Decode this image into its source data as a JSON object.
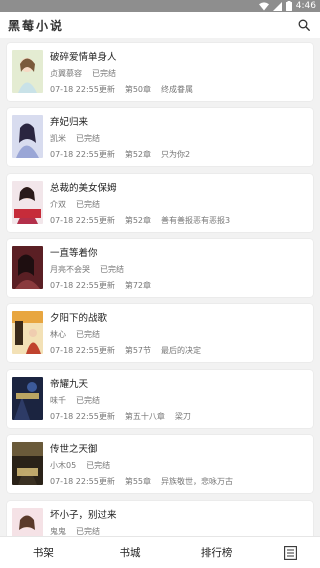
{
  "status_bar": {
    "time": "4:46"
  },
  "app": {
    "title": "黑莓小说"
  },
  "books": [
    {
      "title": "破碎爱情单身人",
      "author": "贞翼慕容",
      "status": "已完结",
      "updated": "07-18 22:55更新",
      "chapter": "第50章",
      "chapter_title": "终成眷属",
      "cover_color": "#dfe7c9"
    },
    {
      "title": "弃妃归来",
      "author": "凯米",
      "status": "已完结",
      "updated": "07-18 22:55更新",
      "chapter": "第52章",
      "chapter_title": "只为你2",
      "cover_color": "#c7cbe2"
    },
    {
      "title": "总裁的美女保姆",
      "author": "介双",
      "status": "已完结",
      "updated": "07-18 22:55更新",
      "chapter": "第52章",
      "chapter_title": "善有善报恶有恶报3",
      "cover_color": "#b32f4a"
    },
    {
      "title": "一直等着你",
      "author": "月亮不会哭",
      "status": "已完结",
      "updated": "07-18 22:55更新",
      "chapter": "第72章",
      "chapter_title": "",
      "cover_color": "#7a2a2d"
    },
    {
      "title": "夕阳下的战歌",
      "author": "林心",
      "status": "已完结",
      "updated": "07-18 22:55更新",
      "chapter": "第57节",
      "chapter_title": "最后的决定",
      "cover_color": "#e8b04a"
    },
    {
      "title": "帝耀九天",
      "author": "味千",
      "status": "已完结",
      "updated": "07-18 22:55更新",
      "chapter": "第五十八章",
      "chapter_title": "梁刀",
      "cover_color": "#1e2a4a"
    },
    {
      "title": "传世之天御",
      "author": "小木05",
      "status": "已完结",
      "updated": "07-18 22:55更新",
      "chapter": "第55章",
      "chapter_title": "异族敬世，悲咏万古",
      "cover_color": "#2b2419"
    },
    {
      "title": "坏小子，别过来",
      "author": "鬼鬼",
      "status": "已完结",
      "updated": "",
      "chapter": "",
      "chapter_title": "",
      "cover_color": "#f0d6dc"
    }
  ],
  "tabs": [
    {
      "label": "书架",
      "active": true
    },
    {
      "label": "书城",
      "active": false
    },
    {
      "label": "排行榜",
      "active": false
    }
  ],
  "colors": {
    "status_bar": "#8e8e8e",
    "accent": "#f4b6b0",
    "background": "#f2f2f2"
  }
}
